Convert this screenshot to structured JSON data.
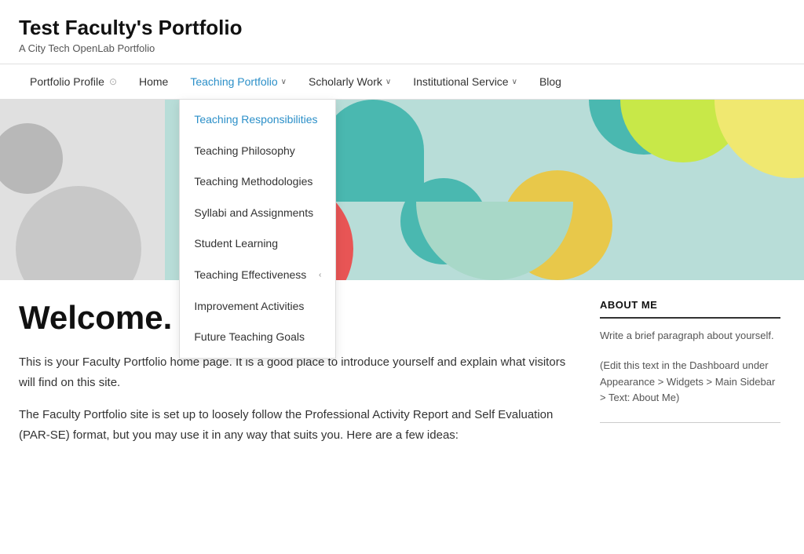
{
  "site": {
    "title": "Test Faculty's Portfolio",
    "subtitle": "A City Tech OpenLab Portfolio"
  },
  "nav": {
    "items": [
      {
        "id": "portfolio-profile",
        "label": "Portfolio Profile",
        "has_icon": true,
        "active": false,
        "has_dropdown": false
      },
      {
        "id": "home",
        "label": "Home",
        "active": false,
        "has_dropdown": false
      },
      {
        "id": "teaching-portfolio",
        "label": "Teaching Portfolio",
        "active": true,
        "has_dropdown": true
      },
      {
        "id": "scholarly-work",
        "label": "Scholarly Work",
        "active": false,
        "has_dropdown": true
      },
      {
        "id": "institutional-service",
        "label": "Institutional Service",
        "active": false,
        "has_dropdown": true
      },
      {
        "id": "blog",
        "label": "Blog",
        "active": false,
        "has_dropdown": false
      }
    ],
    "dropdown_items": [
      {
        "id": "teaching-responsibilities",
        "label": "Teaching Responsibilities",
        "active": true,
        "has_sub": false
      },
      {
        "id": "teaching-philosophy",
        "label": "Teaching Philosophy",
        "active": false,
        "has_sub": false
      },
      {
        "id": "teaching-methodologies",
        "label": "Teaching Methodologies",
        "active": false,
        "has_sub": false
      },
      {
        "id": "syllabi-assignments",
        "label": "Syllabi and Assignments",
        "active": false,
        "has_sub": false
      },
      {
        "id": "student-learning",
        "label": "Student Learning",
        "active": false,
        "has_sub": false
      },
      {
        "id": "teaching-effectiveness",
        "label": "Teaching Effectiveness",
        "active": false,
        "has_sub": true
      },
      {
        "id": "improvement-activities",
        "label": "Improvement Activities",
        "active": false,
        "has_sub": false
      },
      {
        "id": "future-teaching-goals",
        "label": "Future Teaching Goals",
        "active": false,
        "has_sub": false
      }
    ]
  },
  "hero": {
    "alt": "Decorative colorful circles hero image"
  },
  "main": {
    "welcome_heading": "Welcome.",
    "paragraph1": "This is your Faculty Portfolio home page. It is a good place to introduce yourself and explain what visitors will find on this site.",
    "paragraph2": "The Faculty Portfolio site is set up to loosely follow the Professional Activity Report and Self Evaluation (PAR-SE) format, but you may use it in any way that suits you. Here are a few ideas:"
  },
  "sidebar": {
    "about_title": "ABOUT ME",
    "about_text": "Write a brief paragraph about yourself.",
    "about_note": "(Edit this text in the Dashboard under Appearance > Widgets > Main Sidebar > Text: About Me)"
  }
}
